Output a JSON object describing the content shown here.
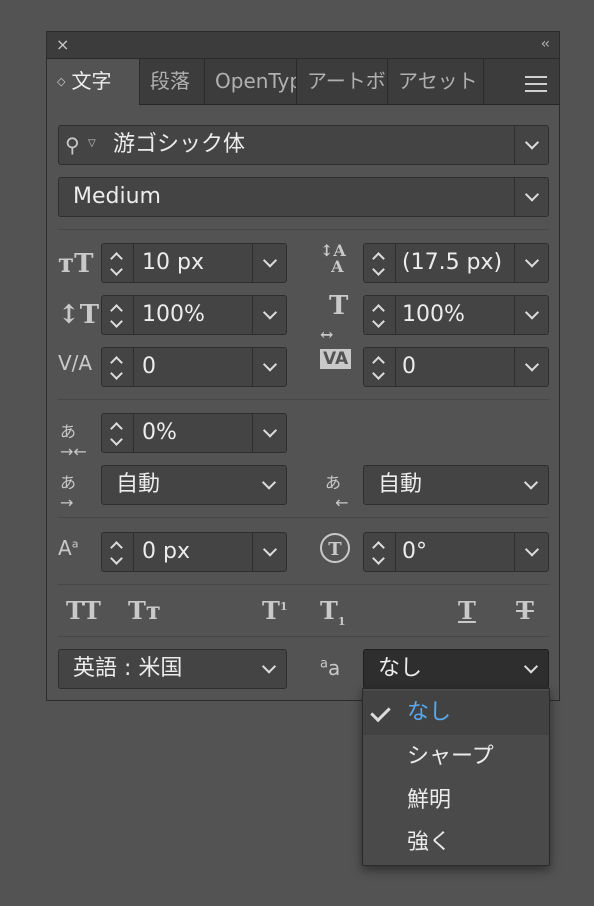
{
  "titlebar": {
    "close_icon": "×",
    "collapse_icon": "‹‹"
  },
  "tabs": [
    {
      "label": "文字",
      "active": true
    },
    {
      "label": "段落",
      "active": false
    },
    {
      "label": "OpenType",
      "active": false
    },
    {
      "label": "アートボード",
      "active": false
    },
    {
      "label": "アセット",
      "active": false
    }
  ],
  "font": {
    "family": "游ゴシック体",
    "style": "Medium"
  },
  "size": {
    "font_size": "10 px",
    "leading": "(17.5 px)"
  },
  "scale": {
    "vertical": "100%",
    "horizontal": "100%"
  },
  "spacing": {
    "kerning": "0",
    "tracking": "0",
    "tsume": "0%"
  },
  "aki": {
    "before": "自動",
    "after": "自動"
  },
  "shift": {
    "baseline": "0 px",
    "rotation": "0°"
  },
  "language": "英語 : 米国",
  "antialias": {
    "value": "なし",
    "options": [
      "なし",
      "シャープ",
      "鮮明",
      "強く"
    ],
    "selected_index": 0
  },
  "colors": {
    "accent": "#5aa9ee",
    "panel": "#535353",
    "field": "#444444"
  }
}
